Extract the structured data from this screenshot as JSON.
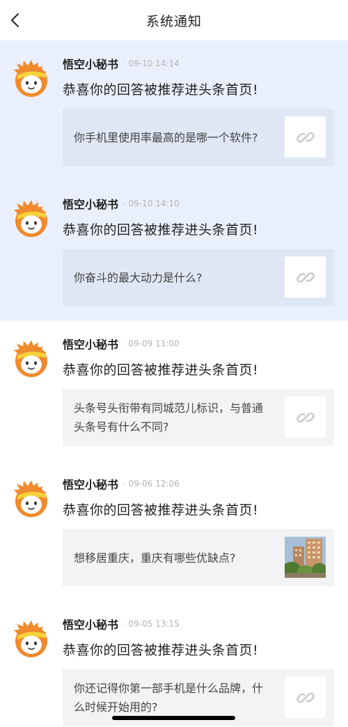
{
  "header": {
    "title": "系统通知",
    "back_icon": "chevron-left-icon"
  },
  "notifications": [
    {
      "sender": "悟空小秘书",
      "separator": "·",
      "time": "09-10 14:14",
      "message": "恭喜你的回答被推荐进头条首页!",
      "question": "你手机里使用率最高的是哪一个软件?",
      "thumbnail": "link-icon",
      "unread": true
    },
    {
      "sender": "悟空小秘书",
      "separator": "·",
      "time": "09-10 14:10",
      "message": "恭喜你的回答被推荐进头条首页!",
      "question": "你奋斗的最大动力是什么?",
      "thumbnail": "link-icon",
      "unread": true
    },
    {
      "sender": "悟空小秘书",
      "separator": "·",
      "time": "09-09 11:00",
      "message": "恭喜你的回答被推荐进头条首页!",
      "question": "头条号头衔带有同城范儿标识，与普通头条号有什么不同?",
      "thumbnail": "link-icon",
      "unread": false
    },
    {
      "sender": "悟空小秘书",
      "separator": "·",
      "time": "09-06 12:06",
      "message": "恭喜你的回答被推荐进头条首页!",
      "question": "想移居重庆，重庆有哪些优缺点?",
      "thumbnail": "building-photo",
      "unread": false
    },
    {
      "sender": "悟空小秘书",
      "separator": "·",
      "time": "09-05 13:15",
      "message": "恭喜你的回答被推荐进头条首页!",
      "question": "你还记得你第一部手机是什么品牌，什么时候开始用的?",
      "thumbnail": "link-icon",
      "unread": false
    }
  ],
  "colors": {
    "unread_background": "#eaf0fb",
    "card_background": "#f2f3f5",
    "avatar_orange": "#f08a2c",
    "avatar_yellow": "#f7d23a"
  }
}
